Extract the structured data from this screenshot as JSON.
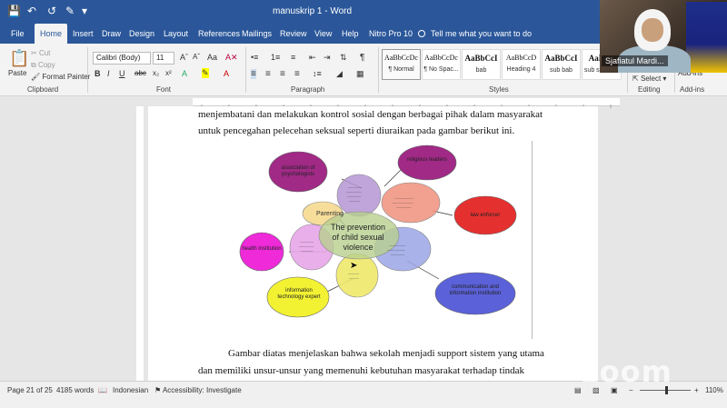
{
  "titlebar": {
    "title": "manuskrip 1 - Word"
  },
  "tabs": [
    {
      "label": "File"
    },
    {
      "label": "Home"
    },
    {
      "label": "Insert"
    },
    {
      "label": "Draw"
    },
    {
      "label": "Design"
    },
    {
      "label": "Layout"
    },
    {
      "label": "References"
    },
    {
      "label": "Mailings"
    },
    {
      "label": "Review"
    },
    {
      "label": "View"
    },
    {
      "label": "Help"
    },
    {
      "label": "Nitro Pro 10"
    }
  ],
  "tellme": "Tell me what you want to do",
  "ribbon": {
    "clipboard": {
      "paste": "Paste",
      "cut": "Cut",
      "copy": "Copy",
      "format_painter": "Format Painter",
      "label": "Clipboard"
    },
    "font": {
      "font_name": "Calibri (Body)",
      "font_size": "11",
      "label": "Font"
    },
    "paragraph": {
      "label": "Paragraph"
    },
    "styles": {
      "label": "Styles",
      "items": [
        {
          "sample": "AaBbCcDc",
          "name": "¶ Normal"
        },
        {
          "sample": "AaBbCcDc",
          "name": "¶ No Spac..."
        },
        {
          "sample": "AaBbCcI",
          "name": "bab"
        },
        {
          "sample": "AaBbCcD",
          "name": "Heading 4"
        },
        {
          "sample": "AaBbCcI",
          "name": "sub bab"
        },
        {
          "sample": "AaBbC",
          "name": "sub sub bab"
        }
      ]
    },
    "editing": {
      "select": "Select",
      "label": "Editing"
    },
    "addins": {
      "addins": "Add-ins",
      "label": "Add-ins"
    }
  },
  "document": {
    "line1": "menjembatani dan melakukan kontrol sosial dengan berbagai pihak dalam masyarakat",
    "line2": "untuk pencegahan pelecehan seksual seperti diuraikan pada gambar berikut ini.",
    "line3": "Gambar diatas menjelaskan bahwa sekolah menjadi support sistem yang utama",
    "line4": "dan memiliki unsur-unsur yang memenuhi kebutuhan masyarakat terhadap tindak"
  },
  "diagram": {
    "center": "The prevention of child sexual violence",
    "nodes": [
      {
        "label": "association of psychologists",
        "color": "#a02a86"
      },
      {
        "label": "religious leaders",
        "color": "#a02a86"
      },
      {
        "label": "law enforcer",
        "color": "#e53030"
      },
      {
        "label": "health institution",
        "color": "#ee2ad9"
      },
      {
        "label": "information technology expert",
        "color": "#f2f233"
      },
      {
        "label": "communication and information institution",
        "color": "#5b61d8"
      },
      {
        "label": "Parenting",
        "color": "#f6dd9a"
      }
    ]
  },
  "status": {
    "page": "Page 21 of 25",
    "words": "4185 words",
    "language": "Indonesian",
    "accessibility": "Accessibility: Investigate",
    "zoom": "110%"
  },
  "video": {
    "name": "Sjafiatul Mardi..."
  },
  "watermark": "zoom"
}
